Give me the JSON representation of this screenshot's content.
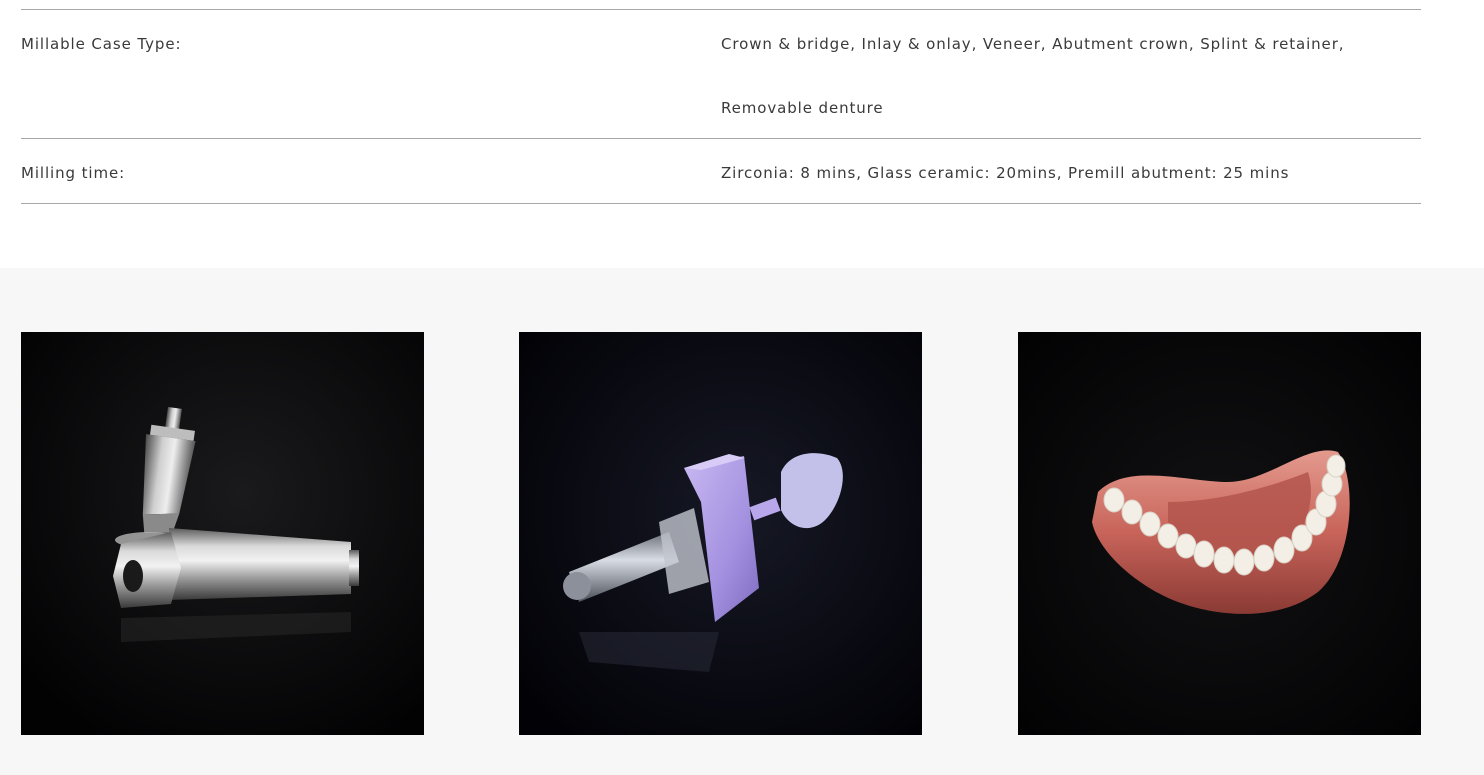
{
  "specs": {
    "rows": [
      {
        "label": "Millable Case Type:",
        "value_lines": [
          "Crown & bridge, Inlay & onlay, Veneer, Abutment crown, Splint & retainer,",
          "Removable denture"
        ]
      },
      {
        "label": "Milling time:",
        "value_lines": [
          "Zirconia: 8 mins, Glass ceramic: 20mins, Premill abutment: 25 mins"
        ]
      }
    ]
  },
  "gallery": {
    "images": [
      {
        "subject": "premill-abutment-photo"
      },
      {
        "subject": "wax-block-crown-photo"
      },
      {
        "subject": "removable-denture-photo"
      }
    ]
  },
  "colors": {
    "divider": "#a8a8a8",
    "gallery_bg": "#f7f7f7",
    "tile_bg": "#020204"
  }
}
